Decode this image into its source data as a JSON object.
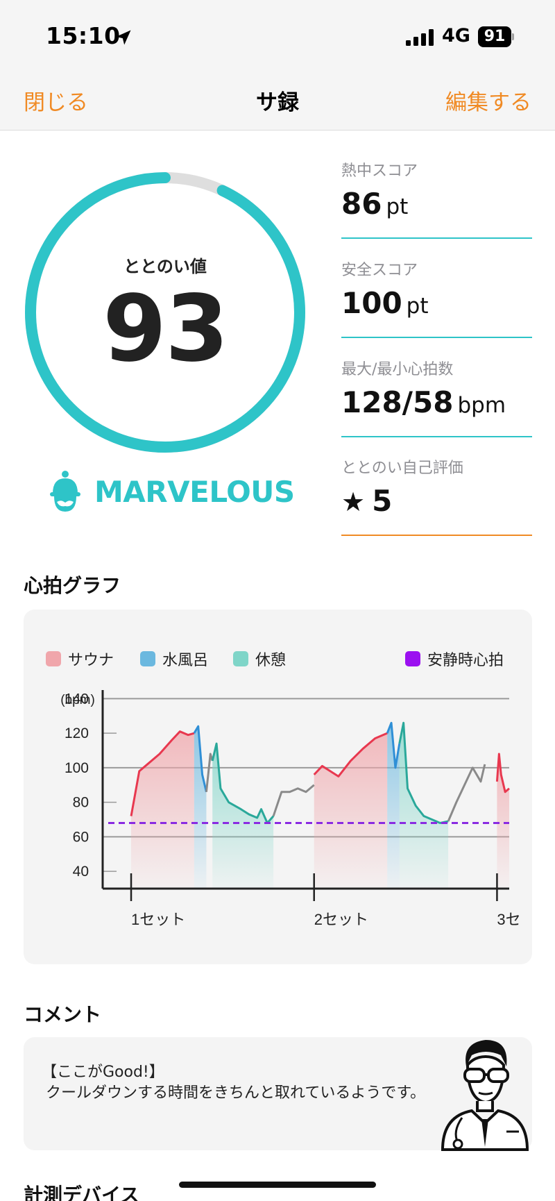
{
  "status_bar": {
    "time": "15:10",
    "network": "4G",
    "battery": "91"
  },
  "nav": {
    "close": "閉じる",
    "title": "サ録",
    "edit": "編集する"
  },
  "score": {
    "label": "ととのい値",
    "value": "93",
    "fraction": 0.93,
    "level": "MARVELOUS"
  },
  "stats": [
    {
      "label": "熱中スコア",
      "value": "86",
      "unit": "pt"
    },
    {
      "label": "安全スコア",
      "value": "100",
      "unit": "pt"
    },
    {
      "label": "最大/最小心拍数",
      "value": "128/58",
      "unit": "bpm"
    },
    {
      "label": "ととのい自己評価",
      "value": "5",
      "icon": "star-icon"
    }
  ],
  "heart_section_title": "心拍グラフ",
  "colors": {
    "accent": "#2ec4c8",
    "orange": "#f08a24",
    "sauna": "#e8384f",
    "water": "#2f8fd6",
    "rest": "#2aa89a",
    "other": "#8a8a8a",
    "resting": "#8a2be2"
  },
  "chart_data": {
    "type": "area",
    "ylabel": "(bpm)",
    "yticks": [
      140,
      120,
      100,
      80,
      60,
      40
    ],
    "ylim": [
      30,
      145
    ],
    "xlim": [
      0,
      1
    ],
    "x_tick_positions": [
      0.07,
      0.52,
      0.97
    ],
    "x_tick_labels": [
      "1セット",
      "2セット",
      "3セ"
    ],
    "legend": [
      {
        "name": "サウナ",
        "color": "#f0a6ab"
      },
      {
        "name": "水風呂",
        "color": "#6bb8df"
      },
      {
        "name": "休憩",
        "color": "#7fd5c8"
      },
      {
        "name": "安静時心拍",
        "color": "#9b10f0"
      }
    ],
    "resting_hr": 68,
    "segments": [
      {
        "phase": "sauna",
        "x": [
          0.07,
          0.09,
          0.11,
          0.14,
          0.17,
          0.19,
          0.21,
          0.225
        ],
        "y": [
          72,
          98,
          102,
          108,
          116,
          121,
          119,
          120
        ]
      },
      {
        "phase": "water",
        "x": [
          0.225,
          0.235,
          0.245,
          0.255
        ],
        "y": [
          120,
          124,
          96,
          86
        ]
      },
      {
        "phase": "other",
        "x": [
          0.255,
          0.265,
          0.27
        ],
        "y": [
          86,
          108,
          104
        ]
      },
      {
        "phase": "rest",
        "x": [
          0.27,
          0.28,
          0.29,
          0.31,
          0.34,
          0.36,
          0.38,
          0.39,
          0.405,
          0.42
        ],
        "y": [
          104,
          114,
          88,
          80,
          76,
          73,
          71,
          76,
          68,
          72
        ]
      },
      {
        "phase": "other",
        "x": [
          0.42,
          0.44,
          0.46,
          0.48,
          0.5,
          0.52
        ],
        "y": [
          72,
          86,
          86,
          88,
          86,
          90
        ]
      },
      {
        "phase": "sauna",
        "x": [
          0.52,
          0.54,
          0.56,
          0.58,
          0.61,
          0.64,
          0.67,
          0.7
        ],
        "y": [
          96,
          101,
          98,
          95,
          104,
          111,
          117,
          120
        ]
      },
      {
        "phase": "water",
        "x": [
          0.7,
          0.71,
          0.72,
          0.73
        ],
        "y": [
          120,
          126,
          100,
          114
        ]
      },
      {
        "phase": "rest",
        "x": [
          0.73,
          0.74,
          0.75,
          0.77,
          0.79,
          0.81,
          0.83,
          0.85
        ],
        "y": [
          114,
          126,
          88,
          78,
          72,
          70,
          68,
          69
        ]
      },
      {
        "phase": "other",
        "x": [
          0.85,
          0.87,
          0.89,
          0.91,
          0.93,
          0.94
        ],
        "y": [
          69,
          80,
          90,
          100,
          92,
          102
        ]
      },
      {
        "phase": "sauna",
        "x": [
          0.97,
          0.975,
          0.98,
          0.99,
          1.0
        ],
        "y": [
          92,
          108,
          96,
          86,
          88
        ]
      }
    ]
  },
  "comment": {
    "title": "コメント",
    "heading": "【ここがGood!】",
    "body": "クールダウンする時間をきちんと取れているようです。"
  },
  "device_title": "計測デバイス"
}
